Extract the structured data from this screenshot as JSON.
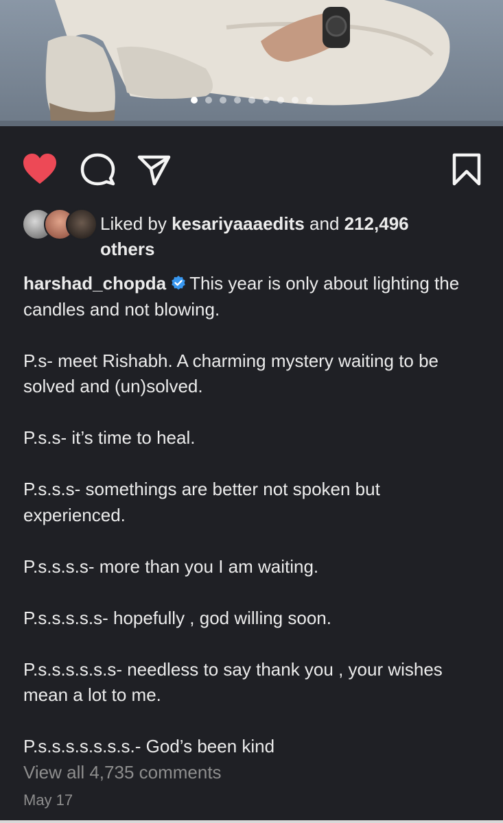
{
  "post": {
    "carousel": {
      "slide_count": 9,
      "active_index": 0
    },
    "actions": {
      "like_icon": "heart-filled-icon",
      "comment_icon": "comment-icon",
      "share_icon": "paper-plane-icon",
      "save_icon": "bookmark-icon",
      "like_color": "#ed4956"
    },
    "likes": {
      "prefix": "Liked by ",
      "user": "kesariyaaaedits",
      "middle": " and ",
      "count": "212,496",
      "suffix": "others"
    },
    "caption": {
      "username": "harshad_chopda",
      "verified_color": "#3897f0",
      "first_line": "This year is only about lighting the candles and not blowing.",
      "paragraphs": [
        "P.s- meet Rishabh. A charming mystery waiting to be solved and (un)solved.",
        "P.s.s- it’s time to heal.",
        "P.s.s.s- somethings are better not spoken but experienced.",
        "P.s.s.s.s- more than you I am waiting.",
        "P.s.s.s.s.s- hopefully , god willing soon.",
        "P.s.s.s.s.s.s- needless to say thank you , your wishes mean a lot to me.",
        "P.s.s.s.s.s.s.s.- God’s been kind"
      ]
    },
    "view_comments": "View all 4,735 comments",
    "date": "May 17"
  }
}
